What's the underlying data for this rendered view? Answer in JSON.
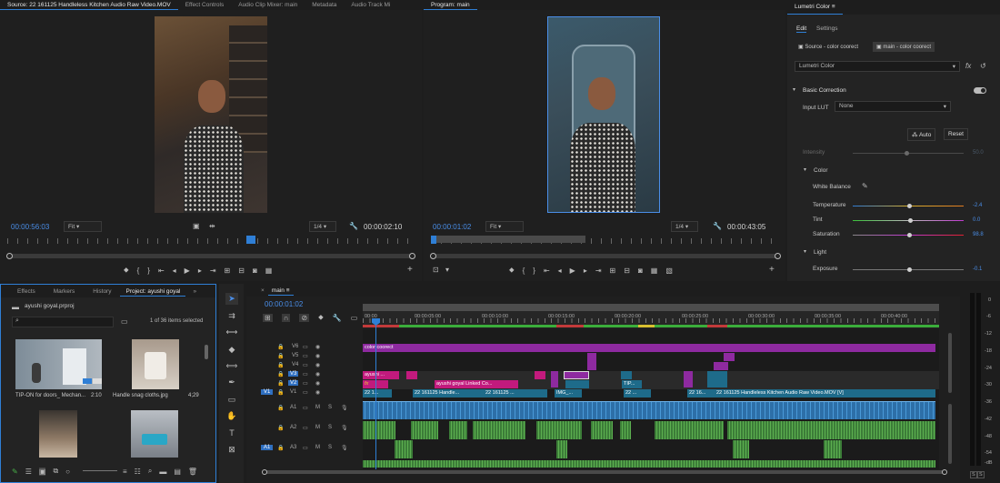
{
  "source_monitor": {
    "tabs": [
      "Source: 22 161125 Handleless Kitchen Audio Raw Video.MOV",
      "Effect Controls",
      "Audio Clip Mixer: main",
      "Metadata",
      "Audio Track Mi"
    ],
    "timecode": "00:00:56:03",
    "fit": "Fit",
    "resolution": "1/4",
    "duration": "00:00:02:10"
  },
  "program_monitor": {
    "tab": "Program: main",
    "timecode": "00:00:01:02",
    "fit": "Fit",
    "resolution": "1/4",
    "duration": "00:00:43:05"
  },
  "lumetri": {
    "tab": "Lumetri Color",
    "subtabs": [
      "Edit",
      "Settings"
    ],
    "source_clip": "Source - color coorect",
    "main_clip": "main - color coorect",
    "effect": "Lumetri Color",
    "section": "Basic Correction",
    "input_lut_label": "Input LUT",
    "input_lut_value": "None",
    "auto": "Auto",
    "reset": "Reset",
    "intensity_label": "Intensity",
    "intensity_value": "50.0",
    "color_section": "Color",
    "white_balance": "White Balance",
    "temperature_label": "Temperature",
    "temperature_value": "-2.4",
    "tint_label": "Tint",
    "tint_value": "0.0",
    "saturation_label": "Saturation",
    "saturation_value": "98.8",
    "light_section": "Light",
    "exposure_label": "Exposure",
    "exposure_value": "-0.1"
  },
  "project": {
    "tabs": [
      "Effects",
      "Markers",
      "History",
      "Project: ayushi goyal"
    ],
    "file": "ayushi goyal.prproj",
    "selected": "1 of 36 items selected",
    "items": [
      {
        "name": "TIP-ON for doors_ Mechan...",
        "duration": "2:10"
      },
      {
        "name": "Handle snag cloths.jpg",
        "duration": "4;29"
      },
      {
        "name": "",
        "duration": ""
      },
      {
        "name": "",
        "duration": ""
      }
    ]
  },
  "timeline": {
    "tab": "main",
    "timecode": "00:00:01:02",
    "ruler": [
      "00:00",
      "00:00:05:00",
      "00:00:10:00",
      "00:00:15:00",
      "00:00:20:00",
      "00:00:25:00",
      "00:00:30:00",
      "00:00:35:00",
      "00:00:40:00"
    ],
    "video_tracks": [
      "V6",
      "V5",
      "V4",
      "V3",
      "V2",
      "V1"
    ],
    "audio_tracks": [
      "A1",
      "A2",
      "A3"
    ],
    "source_patch_v": "V1",
    "source_patch_a": "A1",
    "clips": {
      "color_correct": "color coorect",
      "v3_clip": "ayushi ...",
      "v2_clip": "ayushi goyal Linked Co...",
      "v1_a": "22 1...",
      "v1_b": "22 161125 Handle...",
      "v1_c": "22 161125 ...",
      "v1_d": "IMG_...",
      "v1_e": "22 ...",
      "v1_f": "22 16...",
      "v1_main": "22 161125 Handleless Kitchen Audio Raw Video.MOV [V]",
      "v2_tip": "TIP...",
      "fx": "fx"
    }
  },
  "meter": {
    "scale": [
      "0",
      "-6",
      "-12",
      "-18",
      "-24",
      "-30",
      "-36",
      "-42",
      "-48",
      "-54",
      "-dB"
    ],
    "solo": [
      "S",
      "S"
    ]
  },
  "colors": {
    "timecode_blue": "#4a8ee8",
    "clip_purple": "#8e2aa0",
    "clip_magenta": "#c21a7d",
    "clip_teal": "#1e6b8a",
    "audio_blue": "#2d6fa8",
    "audio_green": "#3c7d38"
  }
}
